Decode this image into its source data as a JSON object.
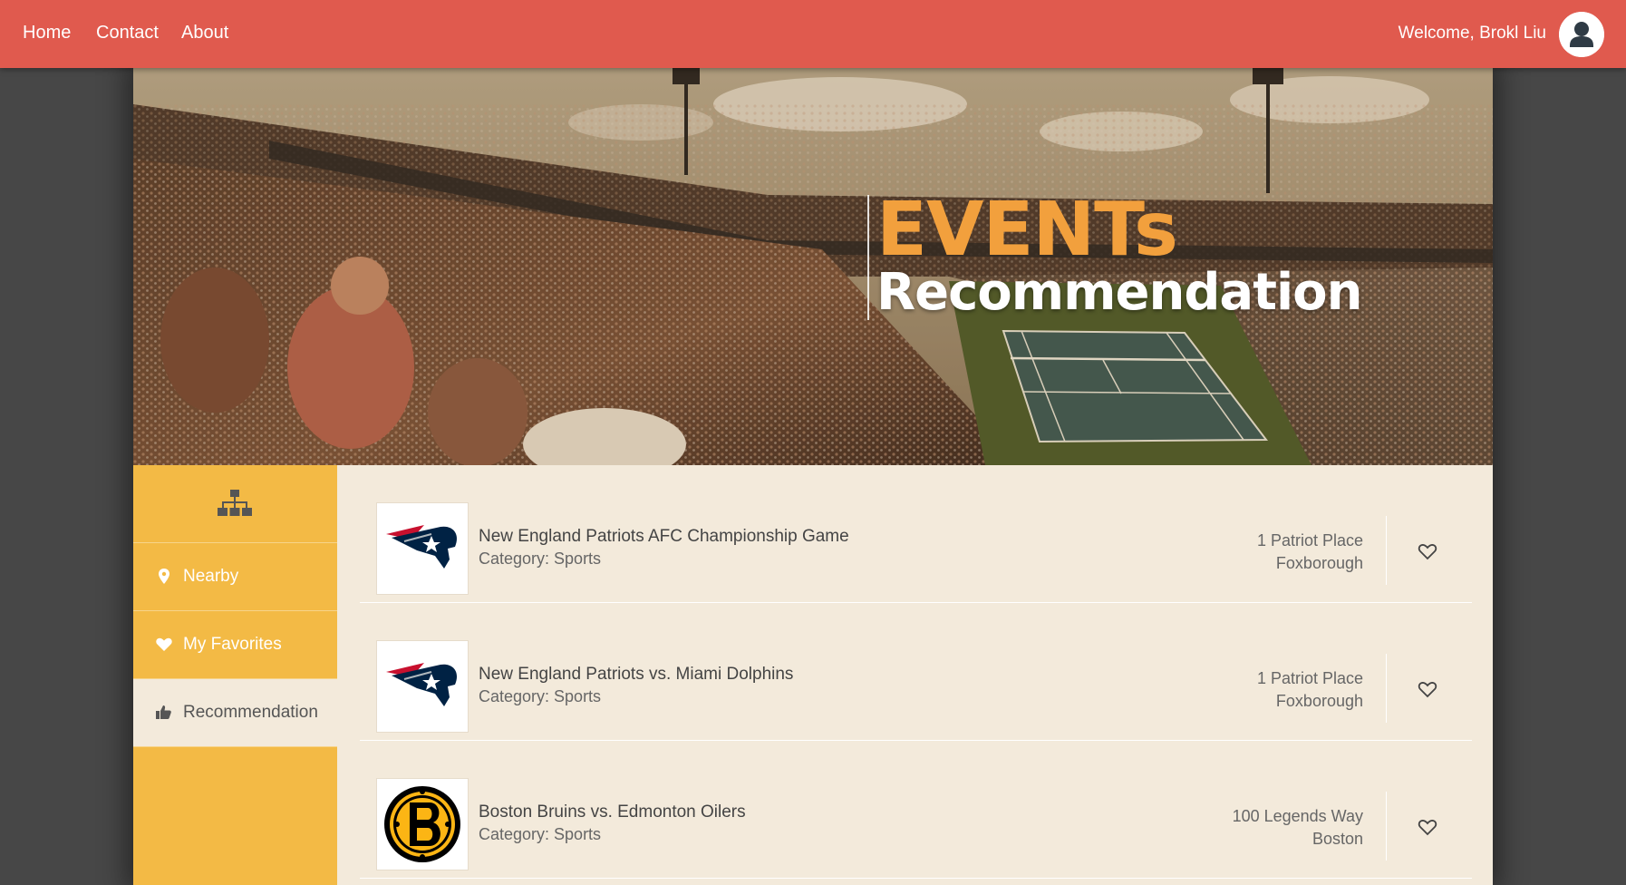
{
  "nav": {
    "links": [
      "Home",
      "Contact",
      "About"
    ],
    "welcome": "Welcome, Brokl Liu",
    "avatar_icon": "user-avatar-icon"
  },
  "hero": {
    "title_line1": "EVENTs",
    "title_line2": "Recommendation"
  },
  "sidebar": {
    "top_icon": "sitemap-icon",
    "items": [
      {
        "label": "Nearby",
        "icon": "map-pin-icon",
        "active": false
      },
      {
        "label": "My Favorites",
        "icon": "heart-icon",
        "active": false
      },
      {
        "label": "Recommendation",
        "icon": "thumbs-up-icon",
        "active": true
      }
    ]
  },
  "events": [
    {
      "name": "New England Patriots AFC Championship Game",
      "category": "Category: Sports",
      "address_line1": "1 Patriot Place",
      "address_line2": "Foxborough",
      "logo": "patriots-logo"
    },
    {
      "name": "New England Patriots vs. Miami Dolphins",
      "category": "Category: Sports",
      "address_line1": "1 Patriot Place",
      "address_line2": "Foxborough",
      "logo": "patriots-logo"
    },
    {
      "name": "Boston Bruins vs. Edmonton Oilers",
      "category": "Category: Sports",
      "address_line1": "100 Legends Way",
      "address_line2": "Boston",
      "logo": "bruins-logo"
    }
  ],
  "colors": {
    "nav_bg": "#e05a4e",
    "sidebar_bg": "#f3ba45",
    "content_bg": "#f3eadb",
    "title_accent": "#f2a03d",
    "page_bg": "#474747"
  }
}
